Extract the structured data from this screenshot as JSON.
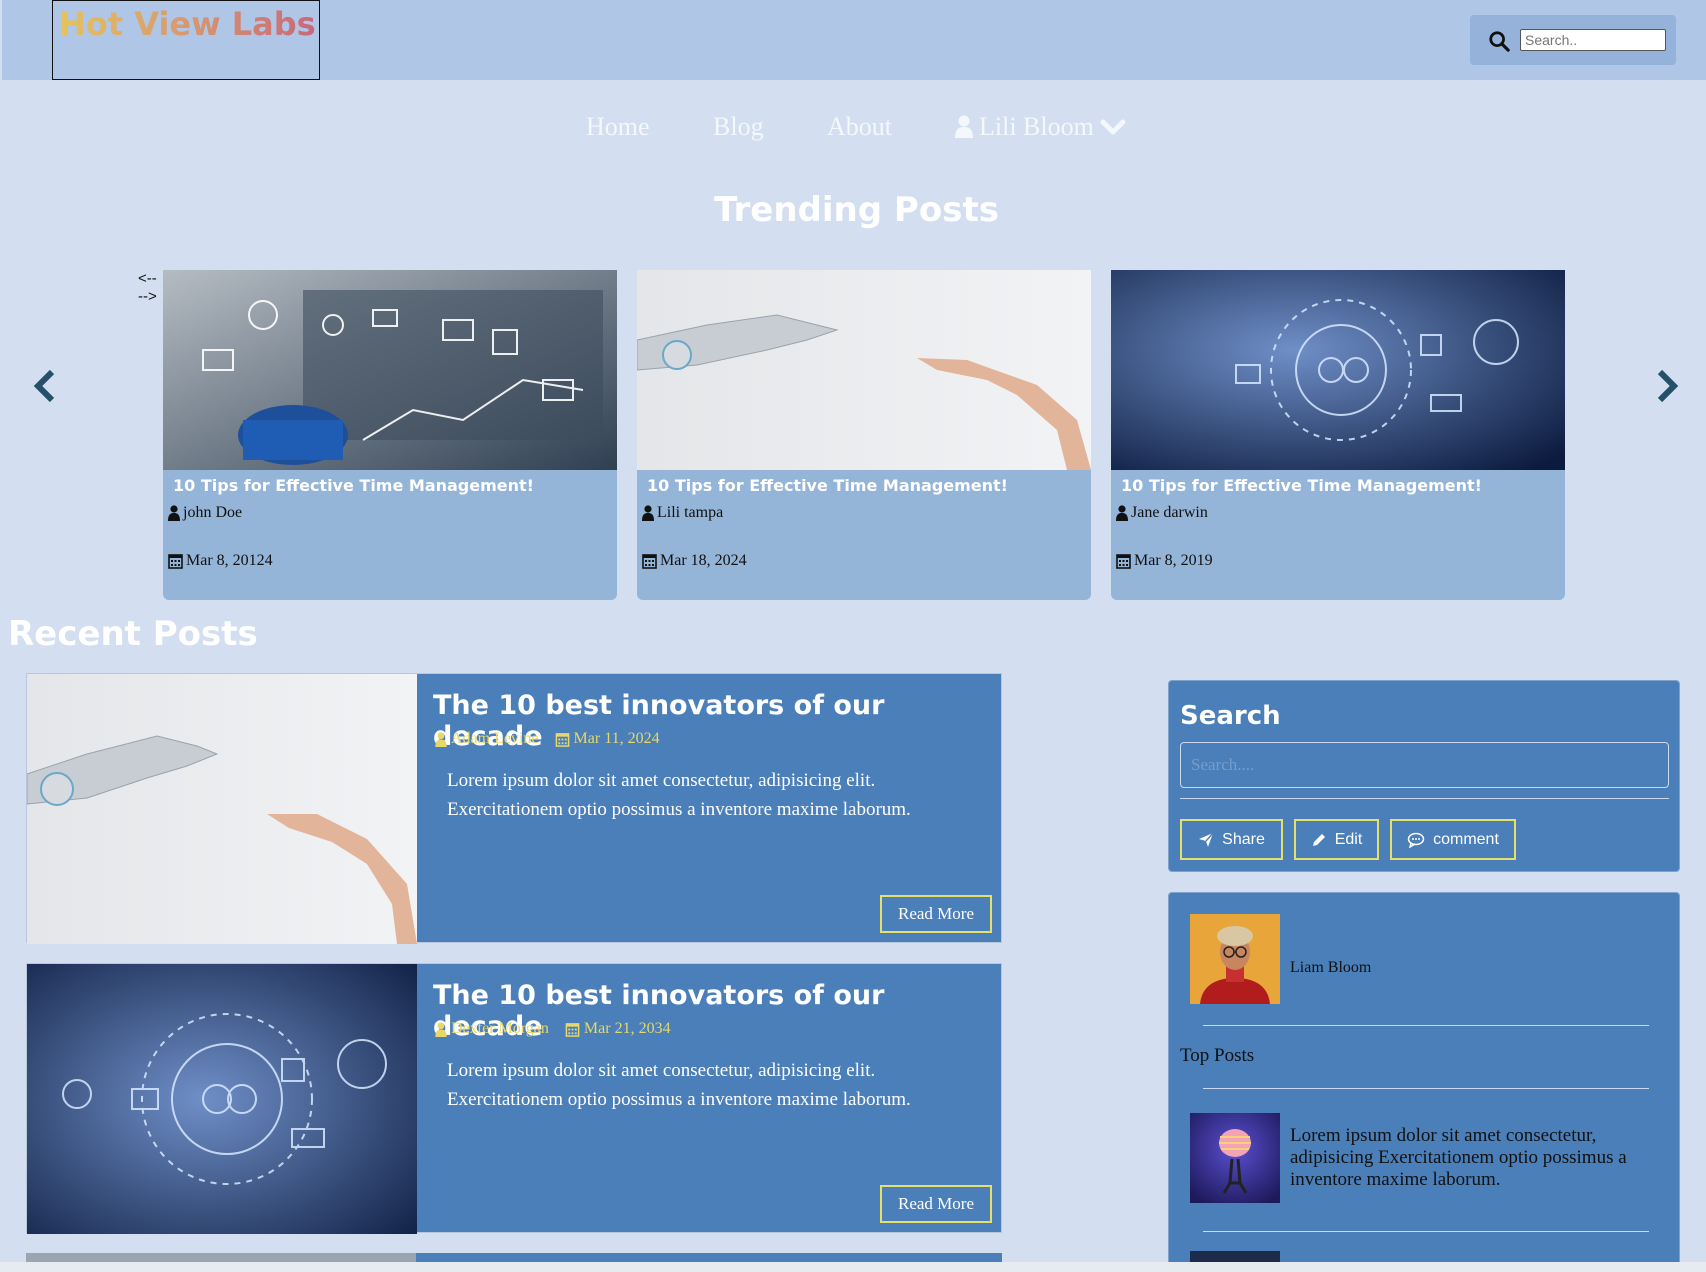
{
  "header": {
    "logo_text": "Hot View Labs",
    "search_placeholder": "Search..",
    "search_icon": "search-icon"
  },
  "nav": {
    "items": [
      {
        "label": "Home"
      },
      {
        "label": "Blog"
      },
      {
        "label": "About"
      }
    ],
    "user": {
      "label": "Lili Bloom",
      "icon": "user-icon",
      "chevron": "chevron-down-icon"
    }
  },
  "trending": {
    "title": "Trending Posts",
    "carousel_alt_text": "<---->",
    "cards": [
      {
        "title": "10 Tips for Effective Time Management!",
        "author": "john Doe",
        "date": "Mar 8, 20124",
        "image": "laptop-digital-icons"
      },
      {
        "title": "10 Tips for Effective Time Management!",
        "author": "Lili tampa",
        "date": "Mar 18, 2024",
        "image": "robot-human-hands"
      },
      {
        "title": "10 Tips for Effective Time Management!",
        "author": "Jane darwin",
        "date": "Mar 8, 2019",
        "image": "tech-network-hand"
      }
    ]
  },
  "recent": {
    "title": "Recent Posts",
    "posts": [
      {
        "title": "The 10 best innovators of our decade",
        "author": "Adam Levine",
        "date": "Mar 11, 2024",
        "excerpt": "Lorem ipsum dolor sit amet consectetur, adipisicing elit. Exercitationem optio possimus a inventore maxime laborum.",
        "button": "Read More",
        "image": "robot-human-hands"
      },
      {
        "title": "The 10 best innovators of our decade",
        "author": "Dexter Morgan",
        "date": "Mar 21, 2034",
        "excerpt": "Lorem ipsum dolor sit amet consectetur, adipisicing elit. Exercitationem optio possimus a inventore maxime laborum.",
        "button": "Read More",
        "image": "tech-network-hand"
      }
    ]
  },
  "sidebar": {
    "search": {
      "heading": "Search",
      "placeholder": "Search....",
      "buttons": [
        {
          "label": "Share",
          "icon": "send-icon"
        },
        {
          "label": "Edit",
          "icon": "pencil-icon"
        },
        {
          "label": "comment",
          "icon": "comment-icon"
        }
      ]
    },
    "profile": {
      "name": "Liam Bloom"
    },
    "top_posts": {
      "heading": "Top Posts",
      "items": [
        {
          "text": "Lorem ipsum dolor sit amet consectetur, adipisicing Exercitationem optio possimus a inventore maxime laborum."
        }
      ]
    }
  },
  "colors": {
    "page_bg": "#d3dff0",
    "header_bg": "#afc6e6",
    "card_bg": "#94b4d8",
    "post_bg": "#4a7fba",
    "accent_yellow": "#e6e06a",
    "arrow": "#24506a"
  }
}
